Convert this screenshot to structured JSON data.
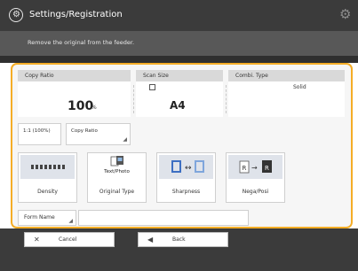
{
  "header": {
    "title": "Settings/Registration",
    "app_icon": "gear-person-icon",
    "settings_icon": "gear-icon"
  },
  "message": "Remove the original from the feeder.",
  "summary": {
    "copy_ratio": {
      "header": "Copy Ratio",
      "value": "100",
      "unit": "%"
    },
    "scan_size": {
      "header": "Scan Size",
      "value": "A4",
      "icon": "paper-icon"
    },
    "combi_type": {
      "header": "Combi. Type",
      "value": "Solid"
    }
  },
  "ratio_buttons": [
    {
      "label": "1:1 (100%)"
    },
    {
      "label": "Copy Ratio"
    }
  ],
  "function_buttons": [
    {
      "label": "Density",
      "icon": "density-scale-icon"
    },
    {
      "label": "Original Type",
      "sublabel": "Text/Photo",
      "icon": "original-type-icon"
    },
    {
      "label": "Sharpness",
      "icon": "sharpness-icon"
    },
    {
      "label": "Nega/Posi",
      "icon": "nega-posi-icon"
    }
  ],
  "form_name": {
    "label": "Form Name",
    "value": ""
  },
  "footer": {
    "cancel": {
      "label": "Cancel",
      "icon": "x-icon"
    },
    "back": {
      "label": "Back",
      "icon": "back-arrow-icon"
    }
  }
}
